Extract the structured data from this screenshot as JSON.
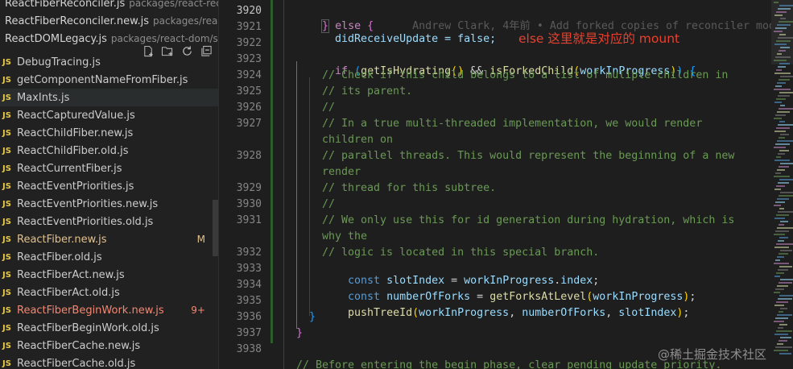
{
  "explorer": {
    "open_editors": [
      {
        "name": "ReactFiberReconciler.js",
        "path": "packages/react-rec..."
      },
      {
        "name": "ReactFiberReconciler.new.js",
        "path": "packages/reac..."
      },
      {
        "name": "ReactDOMLegacy.js",
        "path": "packages/react-dom/sr..."
      }
    ],
    "toolbar_icons": [
      "new-file-icon",
      "new-folder-icon",
      "refresh-icon",
      "collapse-all-icon"
    ],
    "file_type_badge": "JS",
    "files": [
      {
        "name": "DebugTracing.js"
      },
      {
        "name": "getComponentNameFromFiber.js"
      },
      {
        "name": "MaxInts.js"
      },
      {
        "name": "ReactCapturedValue.js"
      },
      {
        "name": "ReactChildFiber.new.js"
      },
      {
        "name": "ReactChildFiber.old.js"
      },
      {
        "name": "ReactCurrentFiber.js"
      },
      {
        "name": "ReactEventPriorities.js"
      },
      {
        "name": "ReactEventPriorities.new.js"
      },
      {
        "name": "ReactEventPriorities.old.js"
      },
      {
        "name": "ReactFiber.new.js",
        "status": "M"
      },
      {
        "name": "ReactFiber.old.js"
      },
      {
        "name": "ReactFiberAct.new.js"
      },
      {
        "name": "ReactFiberAct.old.js"
      },
      {
        "name": "ReactFiberBeginWork.new.js",
        "status": "9+"
      },
      {
        "name": "ReactFiberBeginWork.old.js"
      },
      {
        "name": "ReactFiberCache.new.js"
      },
      {
        "name": "ReactFiberCache.old.js"
      }
    ]
  },
  "editor": {
    "line_numbers": [
      "3920",
      "3921",
      "3922",
      "3923",
      "3924",
      "3925",
      "3926",
      "3927",
      "",
      "3928",
      "",
      "3929",
      "3930",
      "3931",
      "",
      "3932",
      "3933",
      "3934",
      "3935",
      "3936",
      "3937",
      "3938",
      ""
    ],
    "code_text": {
      "l3920_blame": "Andrew Clark, 4年前 • Add forked copies of reconciler modu",
      "l3921": "didReceiveUpdate = false;",
      "l3924": "// Check if this child belongs to a list of muliple children in",
      "l3925": "// its parent.",
      "l3926": "//",
      "l3927a": "// In a true multi-threaded implementation, we would render",
      "l3927b": "children on",
      "l3928a": "// parallel threads. This would represent the beginning of a new",
      "l3928b": "render",
      "l3929": "// thread for this subtree.",
      "l3930": "//",
      "l3931a": "// We only use this for id generation during hydration, which is",
      "l3931b": "why the",
      "l3932": "// logic is located in this special branch.",
      "l3939": "// Before entering the begin phase, clear pending update priority."
    },
    "annotation": "else 这里就是对应的 mount",
    "watermark": "@稀土掘金技术社区"
  },
  "colors": {
    "annotation": "#e8412f",
    "keyword": "#569cd6",
    "control_keyword": "#c586c0",
    "function": "#dcdcaa",
    "variable": "#9cdcfe",
    "comment": "#6a9955",
    "modified_file": "#e2c08d",
    "error_file": "#f48771"
  }
}
